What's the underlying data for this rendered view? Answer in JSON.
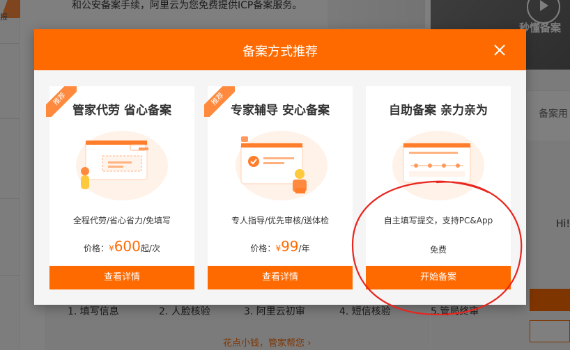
{
  "background": {
    "top_text": "和公安备案手续，阿里云为您免费提供ICP备案服务。",
    "left_text": "报",
    "hero_label": "秒懂备案",
    "right_label": "备案用",
    "right_greeting": "Hi!",
    "steps": [
      "1. 填写信息",
      "2. 人脸核验",
      "3. 阿里云初审",
      "4. 短信核验",
      "5.管局终审"
    ],
    "bottom_link": "花点小钱，管家帮您 ›"
  },
  "modal": {
    "title": "备案方式推荐",
    "close_icon": "close-icon",
    "cards": [
      {
        "badge": "推荐",
        "title": "管家代劳  省心备案",
        "desc": "全程代劳/省心省力/免填写",
        "price_label": "价格：",
        "currency": "¥",
        "price": "600",
        "unit": "起/次",
        "button": "查看详情"
      },
      {
        "badge": "推荐",
        "title": "专家辅导  安心备案",
        "desc": "专人指导/优先审核/送体检",
        "price_label": "价格：",
        "currency": "¥",
        "price": "99",
        "unit": "/年",
        "button": "查看详情"
      },
      {
        "title": "自助备案  亲力亲为",
        "desc": "自主填写提交，支持PC&App",
        "free": "免费",
        "button": "开始备案"
      }
    ]
  },
  "colors": {
    "accent": "#ff6a00",
    "annotation": "#e8251e"
  }
}
